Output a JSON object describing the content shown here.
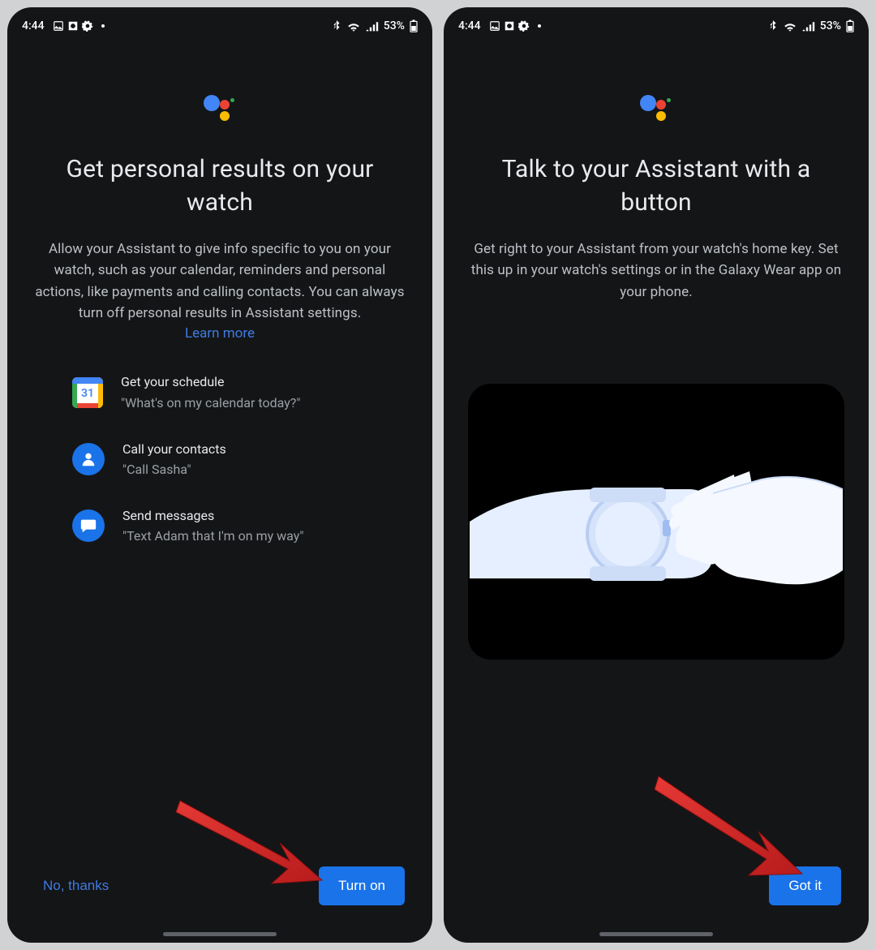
{
  "status": {
    "time": "4:44",
    "battery": "53%"
  },
  "left_screen": {
    "heading": "Get personal results on your watch",
    "body": "Allow your Assistant to give info specific to you on your watch, such as your calendar, reminders and personal actions, like payments and calling contacts. You can always turn off personal results in Assistant settings.",
    "learn_more": "Learn more",
    "features": [
      {
        "title": "Get your schedule",
        "example": "\"What's on my calendar today?\"",
        "icon": "calendar-icon",
        "date": "31"
      },
      {
        "title": "Call your contacts",
        "example": "\"Call Sasha\"",
        "icon": "contacts-icon"
      },
      {
        "title": "Send messages",
        "example": "\"Text Adam that I'm on my way\"",
        "icon": "messages-icon"
      }
    ],
    "secondary_button": "No, thanks",
    "primary_button": "Turn on"
  },
  "right_screen": {
    "heading": "Talk to your Assistant with a button",
    "body": "Get right to your Assistant from your watch's home key. Set this up in your watch's settings or in the Galaxy Wear app on your phone.",
    "primary_button": "Got it"
  }
}
